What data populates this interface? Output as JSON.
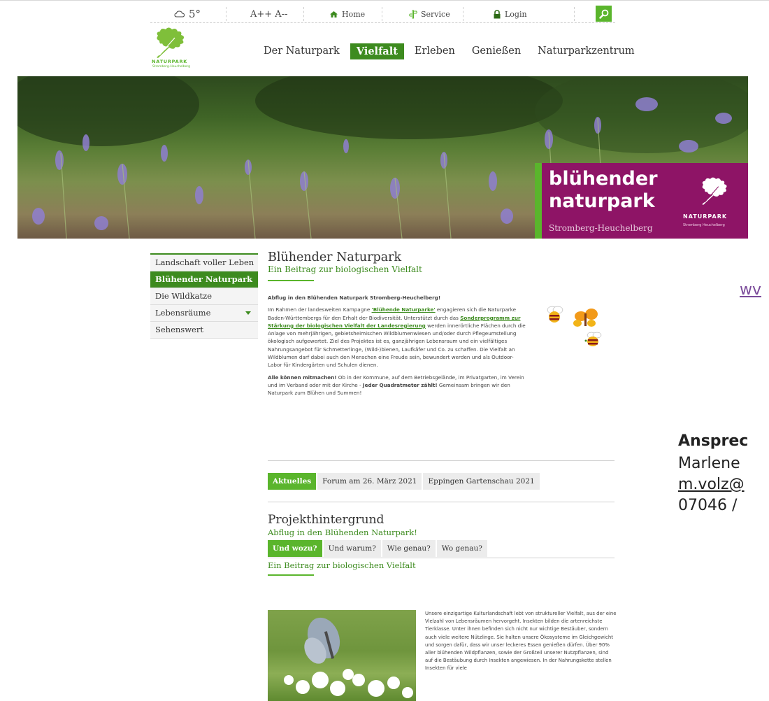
{
  "utility": {
    "weather_temp": "5°",
    "font_size_controls": "A++ A--",
    "home_label": "Home",
    "service_label": "Service",
    "login_label": "Login"
  },
  "logo": {
    "brand": "NATURPARK",
    "sub": "Stromberg-Heuchelberg"
  },
  "main_nav": [
    "Der Naturpark",
    "Vielfalt",
    "Erleben",
    "Genießen",
    "Naturparkzentrum"
  ],
  "main_nav_active": "Vielfalt",
  "hero": {
    "line1": "blühender",
    "line2": "naturpark",
    "region": "Stromberg-Heuchelberg",
    "logo_brand": "NATURPARK",
    "logo_sub": "Stromberg Heuchelberg"
  },
  "sidebar": {
    "items": [
      {
        "label": "Landschaft voller Leben"
      },
      {
        "label": "Blühender Naturpark"
      },
      {
        "label": "Die Wildkatze"
      },
      {
        "label": "Lebensräume"
      },
      {
        "label": "Sehenswert"
      }
    ]
  },
  "article": {
    "title": "Blühender Naturpark",
    "subtitle": "Ein Beitrag zur biologischen Vielfalt",
    "lead": "Abflug in den Blühenden Naturpark Stromberg-Heuchelberg!",
    "p1_a": "Im Rahmen der landesweiten Kampagne ",
    "p1_link1": "'Blühende Naturparke'",
    "p1_b": " engagieren sich die Naturparke Baden-Württembergs für den Erhalt der Biodiversität. Unterstützt durch das ",
    "p1_link2": "Sonderprogramm zur Stärkung der biologischen Vielfalt der Landesregierung",
    "p1_c": " werden innerörtliche Flächen durch die Anlage von mehrjährigen, gebietsheimischen Wildblumenwiesen und/oder durch Pflegeumstellung ökologisch aufgewertet. Ziel des Projektes ist es, ganzjährigen Lebensraum und ein vielfältiges Nahrungsangebot für Schmetterlinge, (Wild-)bienen, Laufkäfer und Co. zu schaffen. Die Vielfalt an Wildblumen darf dabei auch den Menschen eine Freude sein, bewundert werden und als Outdoor-Labor für Kindergärten und Schulen dienen.",
    "p2_bold": "Alle können mitmachen!",
    "p2_a": " Ob in der Kommune, auf dem Betriebsgelände, im Privatgarten, im Verein und im Verband oder mit der Kirche - ",
    "p2_bold2": "Jeder Quadratmeter zählt!",
    "p2_b": " Gemeinsam bringen wir den Naturpark zum Blühen und Summen!"
  },
  "news_tabs": [
    "Aktuelles",
    "Forum am 26. März 2021",
    "Eppingen Gartenschau 2021"
  ],
  "project": {
    "title": "Projekthintergrund",
    "subtitle": "Abflug in den Blühenden Naturpark!",
    "tabs": [
      "Und wozu?",
      "Und warum?",
      "Wie genau?",
      "Wo genau?"
    ],
    "tab_heading": "Ein Beitrag zur biologischen Vielfalt",
    "text": "Unsere einzigartige Kulturlandschaft lebt von struktureller Vielfalt, aus der eine Vielzahl von Lebensräumen hervorgeht. Insekten bilden die artenreichste Tierklasse. Unter ihnen befinden sich nicht nur wichtige Bestäuber, sondern auch viele weitere Nützlinge. Sie halten unsere Ökosysteme im Gleichgewicht und sorgen dafür, dass wir unser leckeres Essen genießen dürfen. Über 90% aller blühenden Wildpflanzen, sowie der Großteil unserer Nutzpflanzen, sind auf die Bestäubung durch Insekten angewiesen. In der Nahrungskette stellen Insekten für viele"
  },
  "right_panel": {
    "link": "wv",
    "contact_heading": "Ansprec",
    "contact_name": "Marlene",
    "contact_email": "m.volz@",
    "contact_phone": "07046 /"
  },
  "colors": {
    "green_dark": "#3d8b1f",
    "green_light": "#5ab52c",
    "magenta": "#8e1466"
  }
}
